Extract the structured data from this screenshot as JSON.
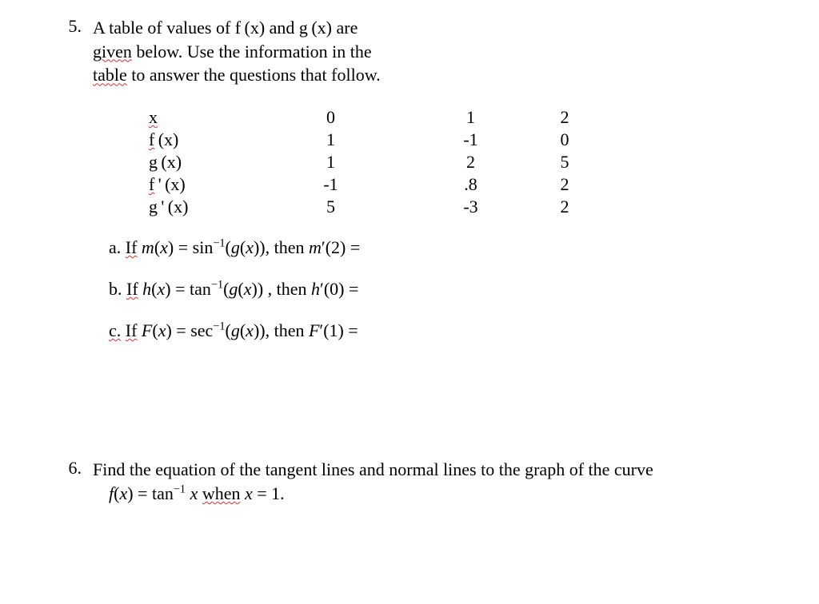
{
  "p5": {
    "num": "5.",
    "intro1a": "A table of values of f",
    "intro1b": "(x) and g",
    "intro1c": "(x) are",
    "intro2a": "given",
    "intro2b": " below. Use the information in the",
    "intro3a": "table",
    "intro3b": " to answer the questions that follow.",
    "table": {
      "r0": {
        "lbl": "x",
        "c0": "0",
        "c1": "1",
        "c2": "2"
      },
      "r1": {
        "lbl_a": "f",
        "lbl_b": "(x)",
        "c0": "1",
        "c1": "-1",
        "c2": "0"
      },
      "r2": {
        "lbl_a": "g",
        "lbl_b": "(x)",
        "c0": "1",
        "c1": "2",
        "c2": "5"
      },
      "r3": {
        "lbl_a": "f",
        "lbl_mid": "'",
        "lbl_b": "(x)",
        "c0": "-1",
        "c1": ".8",
        "c2": "2"
      },
      "r4": {
        "lbl_a": "g",
        "lbl_mid": "'",
        "lbl_b": "(x)",
        "c0": "5",
        "c1": "-3",
        "c2": "2"
      }
    },
    "a": {
      "pre": "a. ",
      "if": "If",
      "mid1": " m",
      "mid2": "(",
      "mid3": "x",
      "mid4": ") = sin",
      "sup": "−1",
      "mid5": "(",
      "mid6": "g",
      "mid7": "(",
      "mid8": "x",
      "mid9": ")), then  ",
      "mres": "m",
      "prime": "′(2) ="
    },
    "b": {
      "pre": "b. ",
      "if": "If",
      "mid1": " h",
      "mid2": "(",
      "mid3": "x",
      "mid4": ") = tan",
      "sup": "−1",
      "mid5": "(",
      "mid6": "g",
      "mid7": "(",
      "mid8": "x",
      "mid9": ")) , then  ",
      "mres": "h",
      "prime": "′(0) ="
    },
    "c": {
      "pre_a": "c.",
      "pre_b": "  ",
      "if": "If",
      "mid1": " F",
      "mid2": "(",
      "mid3": "x",
      "mid4": ") = sec",
      "sup": "−1",
      "mid5": "(",
      "mid6": "g",
      "mid7": "(",
      "mid8": "x",
      "mid9": ")), then  ",
      "mres": "F",
      "prime": "′(1) ="
    }
  },
  "p6": {
    "num": "6.",
    "l1": "Find the equation of the tangent lines and normal lines to the graph of the curve",
    "l2a": "f",
    "l2b": "(",
    "l2c": "x",
    "l2d": ") = tan",
    "l2sup": "−1",
    "l2e": " x",
    "l2f": " ",
    "l2g": "when",
    "l2h": " ",
    "l2i": " x",
    "l2j": " = 1."
  }
}
